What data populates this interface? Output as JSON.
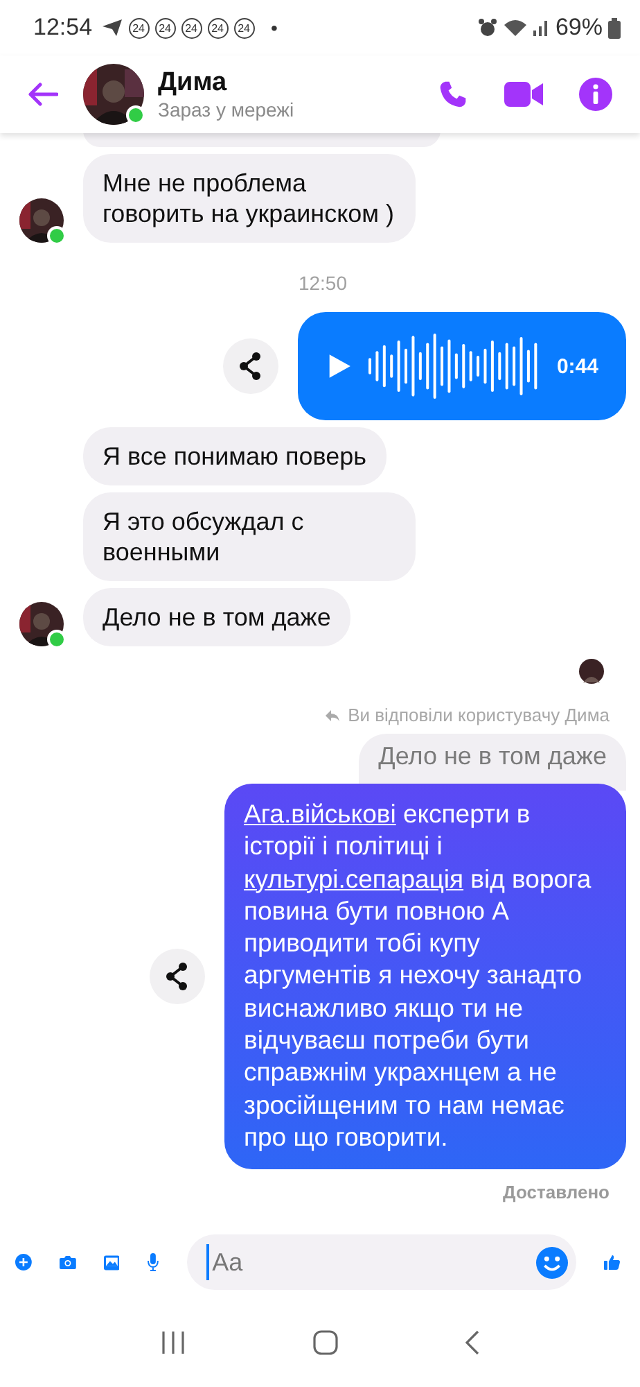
{
  "status_bar": {
    "time": "12:54",
    "notifications": [
      "24",
      "24",
      "24",
      "24",
      "24"
    ],
    "dot": "•",
    "battery": "69%"
  },
  "header": {
    "name": "Дима",
    "status": "Зараз у мережі",
    "online": true
  },
  "messages": [
    {
      "kind": "text",
      "outgoing": false,
      "text": "Мне не проблема говорить на украинском )",
      "avatar": true
    },
    {
      "kind": "time",
      "text": "12:50"
    },
    {
      "kind": "voice",
      "outgoing": true,
      "duration": "0:44"
    },
    {
      "kind": "text",
      "outgoing": false,
      "text": "Я все понимаю поверь",
      "avatar": false
    },
    {
      "kind": "text",
      "outgoing": false,
      "text": "Я это обсуждал с военными",
      "avatar": false
    },
    {
      "kind": "text",
      "outgoing": false,
      "text": "Дело не в том даже",
      "avatar": true
    },
    {
      "kind": "seen"
    },
    {
      "kind": "reply",
      "label": "Ви відповіли користувачу Дима",
      "quote": "Дело не в том даже"
    },
    {
      "kind": "rich",
      "outgoing": true,
      "parts": [
        {
          "text": "Ага.військові",
          "link": true
        },
        {
          "text": " експерти в історії і політиці і ",
          "link": false
        },
        {
          "text": "культурі.сепарація",
          "link": true
        },
        {
          "text": " від ворога повина бути повною А приводити тобі купу аргументів я нехочу занадто виснажливо якщо ти не відчуваєш потреби бути справжнім украхнцем а не зросійщеним то нам немає про що говорити.",
          "link": false
        }
      ]
    },
    {
      "kind": "status",
      "text": "Доставлено"
    }
  ],
  "composer": {
    "placeholder": "Aa"
  }
}
